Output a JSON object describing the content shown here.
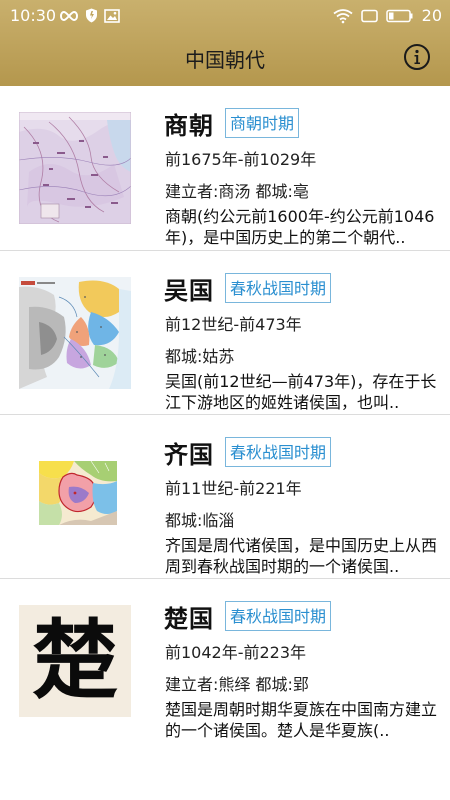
{
  "status_bar": {
    "time": "10:30",
    "battery": "20",
    "left_icons": [
      "infinity-icon",
      "shield-icon",
      "image-icon"
    ],
    "right_icons": [
      "wifi-icon",
      "tablet-icon",
      "battery-icon"
    ]
  },
  "header": {
    "title": "中国朝代",
    "info_icon": "info-icon"
  },
  "colors": {
    "header_gold": "#c0a55f",
    "tag_blue": "#2a8fd0",
    "tag_border": "#79b6dc",
    "divider": "#dcdcdc"
  },
  "items": [
    {
      "name": "商朝",
      "tag": "商朝时期",
      "period": "前1675年-前1029年",
      "meta": "建立者:商汤  都城:亳",
      "desc": "商朝(约公元前1600年-约公元前1046年)，是中国历史上的第二个朝代..",
      "image": "ancient-map-thumbnail"
    },
    {
      "name": "吴国",
      "tag": "春秋战国时期",
      "period": "前12世纪-前473年",
      "meta": "都城:姑苏",
      "desc": "吴国(前12世纪—前473年)，存在于长江下游地区的姬姓诸侯国，也叫..",
      "image": "relief-map-thumbnail"
    },
    {
      "name": "齐国",
      "tag": "春秋战国时期",
      "period": "前11世纪-前221年",
      "meta": "都城:临淄",
      "desc": "齐国是周代诸侯国，是中国历史上从西周到春秋战国时期的一个诸侯国..",
      "image": "territory-map-thumbnail"
    },
    {
      "name": "楚国",
      "tag": "春秋战国时期",
      "period": "前1042年-前223年",
      "meta": "建立者:熊绎  都城:郢",
      "desc": "楚国是周朝时期华夏族在中国南方建立的一个诸侯国。楚人是华夏族(..",
      "image": "calligraphy-thumbnail",
      "image_text": "楚"
    }
  ]
}
